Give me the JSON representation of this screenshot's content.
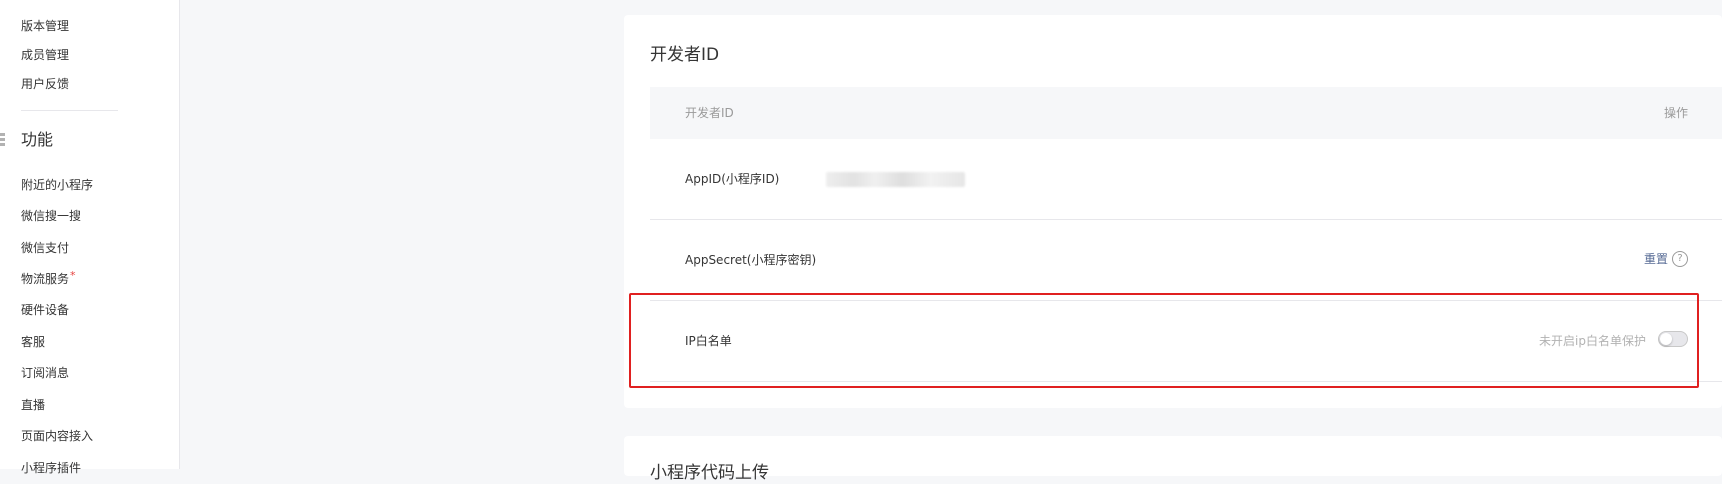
{
  "sidebar": {
    "items_top": [
      "版本管理",
      "成员管理",
      "用户反馈"
    ],
    "group_title": "功能",
    "group_items": [
      {
        "label": "附近的小程序",
        "badge": ""
      },
      {
        "label": "微信搜一搜",
        "badge": ""
      },
      {
        "label": "微信支付",
        "badge": ""
      },
      {
        "label": "物流服务",
        "badge": "*"
      },
      {
        "label": "硬件设备",
        "badge": ""
      },
      {
        "label": "客服",
        "badge": ""
      },
      {
        "label": "订阅消息",
        "badge": ""
      },
      {
        "label": "直播",
        "badge": ""
      },
      {
        "label": "页面内容接入",
        "badge": ""
      },
      {
        "label": "小程序插件",
        "badge": ""
      }
    ]
  },
  "developer_card": {
    "title": "开发者ID",
    "table_headers": {
      "id": "开发者ID",
      "action": "操作"
    },
    "rows": {
      "appid_label": "AppID(小程序ID)",
      "secret_label": "AppSecret(小程序密钥)",
      "secret_action": "重置",
      "ip_label": "IP白名单",
      "ip_status": "未开启ip白名单保护"
    },
    "ip_toggle_on": false
  },
  "next_card": {
    "title": "小程序代码上传"
  },
  "colors": {
    "link": "#576b95",
    "highlight": "#e02020",
    "page_bg": "#f6f7f9"
  }
}
